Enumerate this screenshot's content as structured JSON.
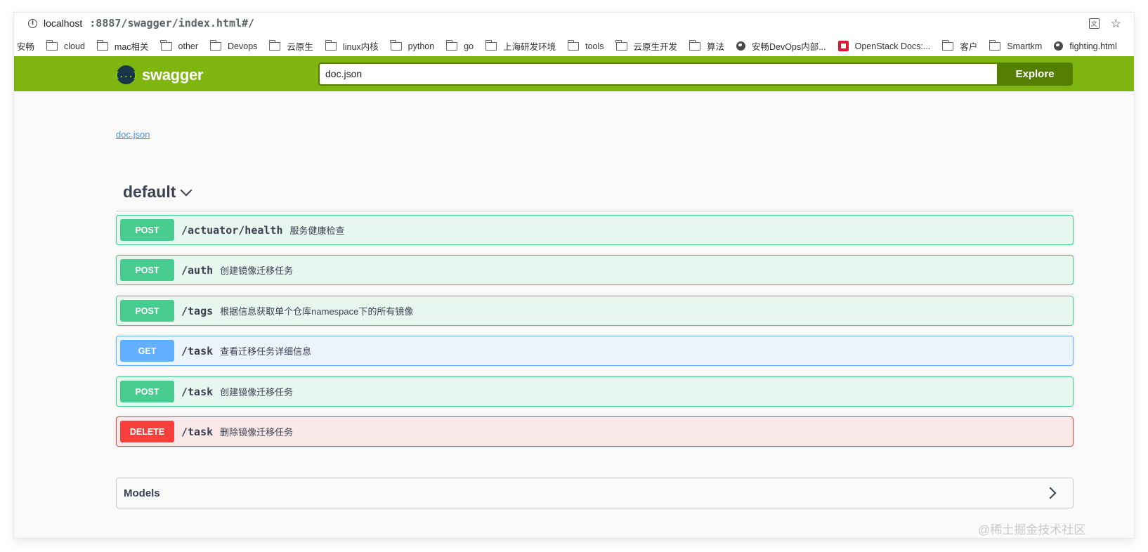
{
  "browser": {
    "url_host": "localhost",
    "url_path": ":8887/swagger/index.html#/",
    "bookmarks": [
      {
        "label": "安畅",
        "icon": "none"
      },
      {
        "label": "cloud",
        "icon": "folder-icon"
      },
      {
        "label": "mac相关",
        "icon": "folder-icon"
      },
      {
        "label": "other",
        "icon": "folder-icon"
      },
      {
        "label": "Devops",
        "icon": "folder-icon"
      },
      {
        "label": "云原生",
        "icon": "folder-icon"
      },
      {
        "label": "linux内核",
        "icon": "folder-icon"
      },
      {
        "label": "python",
        "icon": "folder-icon"
      },
      {
        "label": "go",
        "icon": "folder-icon"
      },
      {
        "label": "上海研发环境",
        "icon": "folder-icon"
      },
      {
        "label": "tools",
        "icon": "folder-icon"
      },
      {
        "label": "云原生开发",
        "icon": "folder-icon"
      },
      {
        "label": "算法",
        "icon": "folder-icon"
      },
      {
        "label": "安畅DevOps内部...",
        "icon": "globe-icon"
      },
      {
        "label": "OpenStack Docs:...",
        "icon": "openstack-icon"
      },
      {
        "label": "客户",
        "icon": "folder-icon"
      },
      {
        "label": "Smartkm",
        "icon": "folder-icon"
      },
      {
        "label": "fighting.html",
        "icon": "globe-icon"
      }
    ]
  },
  "topbar": {
    "logo_symbol": "{...}",
    "logo_text": "swagger",
    "spec_url_value": "doc.json",
    "explore_label": "Explore",
    "brand_color": "#7eb60f",
    "dark_brand_color": "#547f00"
  },
  "main": {
    "doc_link": "doc.json",
    "section_title": "default",
    "operations": [
      {
        "method": "POST",
        "path": "/actuator/health",
        "summary": "服务健康检查"
      },
      {
        "method": "POST",
        "path": "/auth",
        "summary": "创建镜像迁移任务"
      },
      {
        "method": "POST",
        "path": "/tags",
        "summary": "根据信息获取单个仓库namespace下的所有镜像"
      },
      {
        "method": "GET",
        "path": "/task",
        "summary": "查看迁移任务详细信息"
      },
      {
        "method": "POST",
        "path": "/task",
        "summary": "创建镜像迁移任务"
      },
      {
        "method": "DELETE",
        "path": "/task",
        "summary": "删除镜像迁移任务"
      }
    ],
    "models_label": "Models"
  },
  "colors": {
    "post": "#49cc90",
    "get": "#61affe",
    "delete": "#f93e3e"
  },
  "watermark": "@稀土掘金技术社区"
}
